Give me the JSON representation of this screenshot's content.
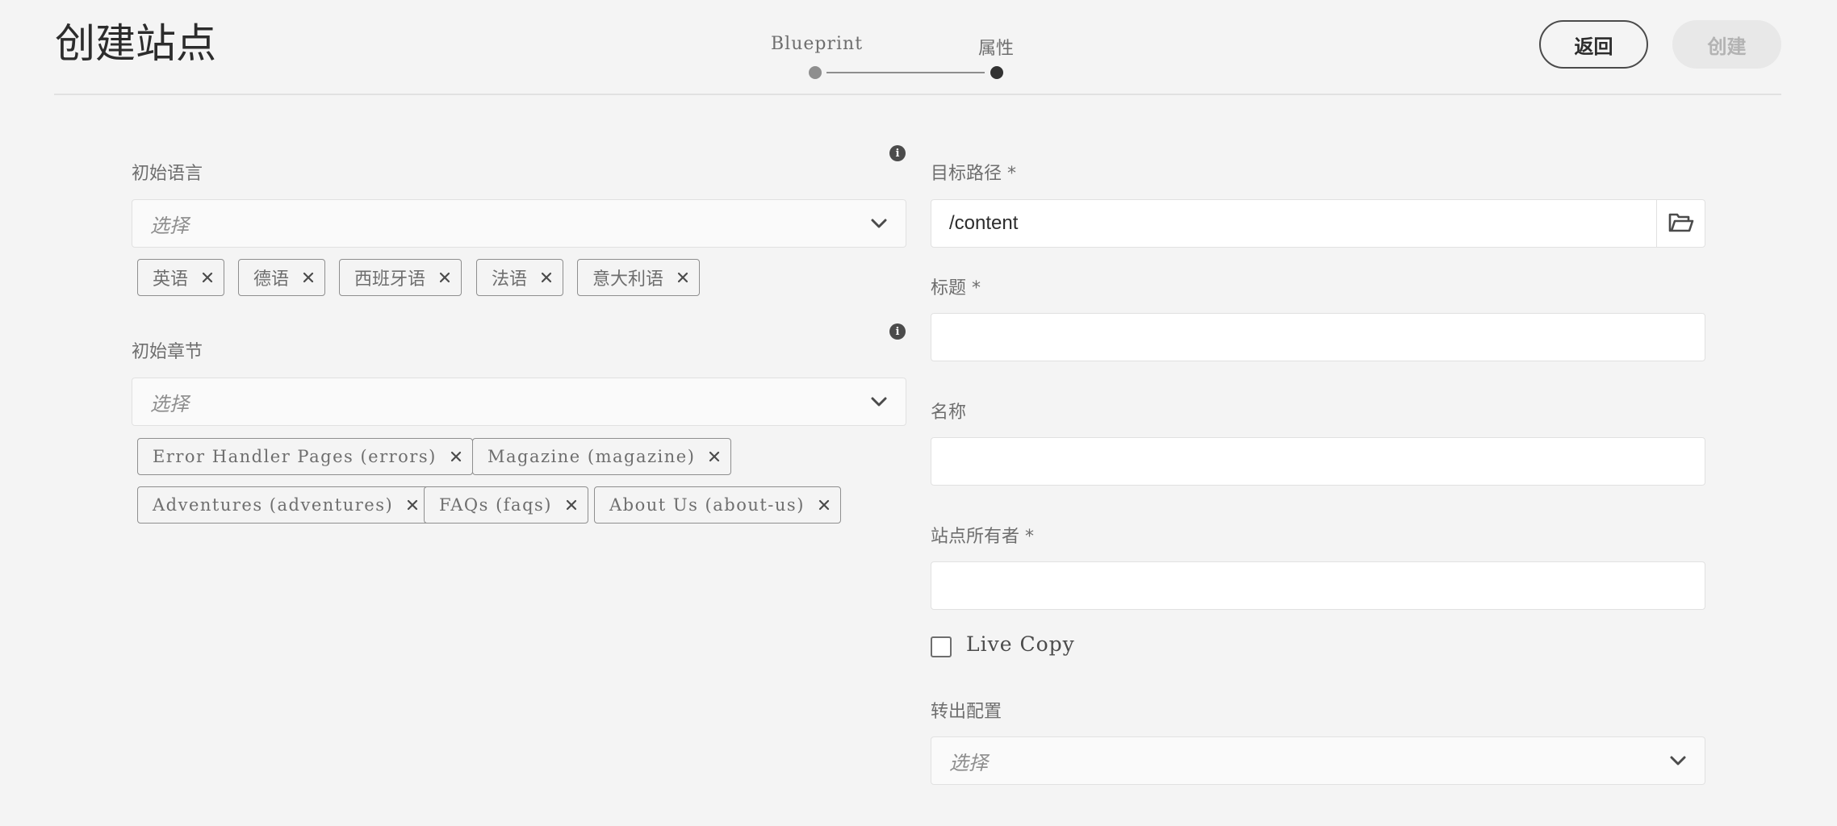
{
  "header": {
    "title": "创建站点",
    "steps": [
      {
        "label": "Blueprint",
        "state": "done"
      },
      {
        "label": "属性",
        "state": "current"
      }
    ],
    "back_label": "返回",
    "create_label": "创建"
  },
  "left": {
    "initial_languages": {
      "label": "初始语言",
      "placeholder": "选择",
      "tags": [
        "英语",
        "德语",
        "西班牙语",
        "法语",
        "意大利语"
      ]
    },
    "initial_chapters": {
      "label": "初始章节",
      "placeholder": "选择",
      "tags": [
        "Error Handler Pages (errors)",
        "Magazine (magazine)",
        "Adventures (adventures)",
        "FAQs (faqs)",
        "About Us (about-us)"
      ]
    }
  },
  "right": {
    "target_path": {
      "label": "目标路径 *",
      "value": "/content"
    },
    "title": {
      "label": "标题 *",
      "value": ""
    },
    "name": {
      "label": "名称",
      "value": ""
    },
    "site_owner": {
      "label": "站点所有者 *",
      "value": ""
    },
    "live_copy": {
      "label": "Live Copy",
      "checked": false
    },
    "rollout_config": {
      "label": "转出配置",
      "placeholder": "选择"
    }
  },
  "icons": {
    "info": "info-icon",
    "chevron": "chevron-down-icon",
    "folder": "folder-icon",
    "close": "close-icon"
  }
}
